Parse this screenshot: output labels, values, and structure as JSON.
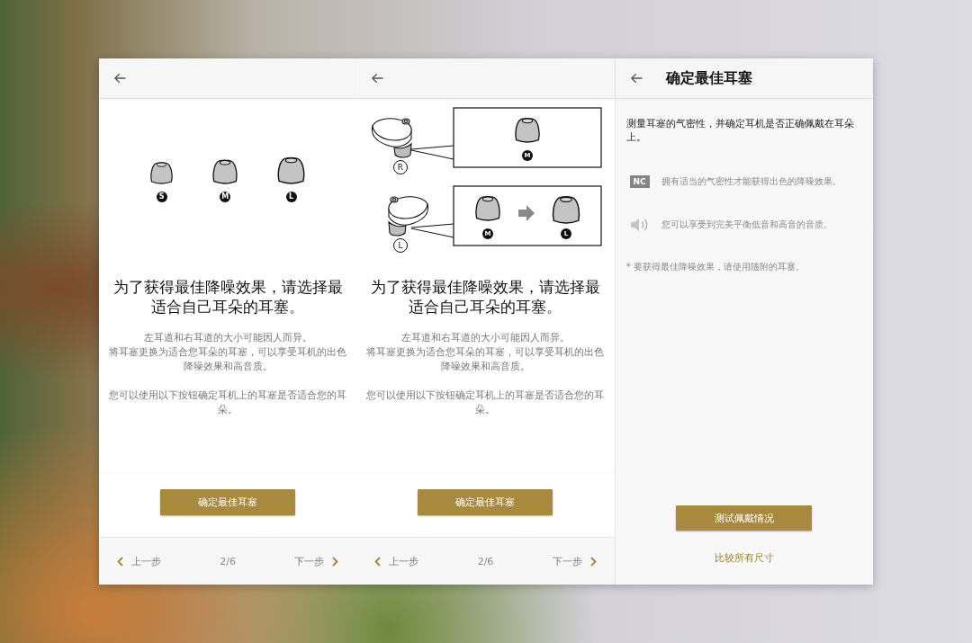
{
  "screens": [
    {
      "kind": "size_guide",
      "illustration": {
        "kind": "tip_sizes",
        "tips": [
          {
            "size": "S"
          },
          {
            "size": "M"
          },
          {
            "size": "L"
          }
        ]
      },
      "heading": "为了获得最佳降噪效果，请选择最适合自己耳朵的耳塞。",
      "paragraphs": [
        [
          "左耳道和右耳道的大小可能因人而异。",
          "将耳塞更换为适合您耳朵的耳塞，可以享受耳机的出色降噪效果和高音质。"
        ],
        [
          "您可以使用以下按钮确定耳机上的耳塞是否适合您的耳朵。"
        ]
      ],
      "button": "确定最佳耳塞",
      "nav": {
        "previous": "上一步",
        "page": "2/6",
        "next": "下一步"
      }
    },
    {
      "kind": "size_guide",
      "illustration": {
        "kind": "fitting",
        "rows": [
          {
            "side": "R",
            "tips": [
              {
                "size": "M"
              }
            ]
          },
          {
            "side": "L",
            "tips": [
              {
                "size": "M"
              },
              {
                "size": "L"
              }
            ]
          }
        ]
      },
      "heading": "为了获得最佳降噪效果，请选择最适合自己耳朵的耳塞。",
      "paragraphs": [
        [
          "左耳道和右耳道的大小可能因人而异。",
          "将耳塞更换为适合您耳朵的耳塞，可以享受耳机的出色降噪效果和高音质。"
        ],
        [
          "您可以使用以下按钮确定耳机上的耳塞是否适合您的耳朵。"
        ]
      ],
      "button": "确定最佳耳塞",
      "nav": {
        "previous": "上一步",
        "page": "2/6",
        "next": "下一步"
      }
    },
    {
      "kind": "fit_test",
      "title": "确定最佳耳塞",
      "description": "测量耳塞的气密性，并确定耳机是否正确佩戴在耳朵上。",
      "features": [
        {
          "kind": "nc",
          "badge": "NC",
          "text": "拥有适当的气密性才能获得出色的降噪效果。"
        },
        {
          "kind": "sound",
          "text": "您可以享受到完美平衡低音和高音的音质。"
        }
      ],
      "note": "* 要获得最佳降噪效果，请使用随附的耳塞。",
      "button": "测试佩戴情况",
      "link": "比较所有尺寸"
    }
  ]
}
